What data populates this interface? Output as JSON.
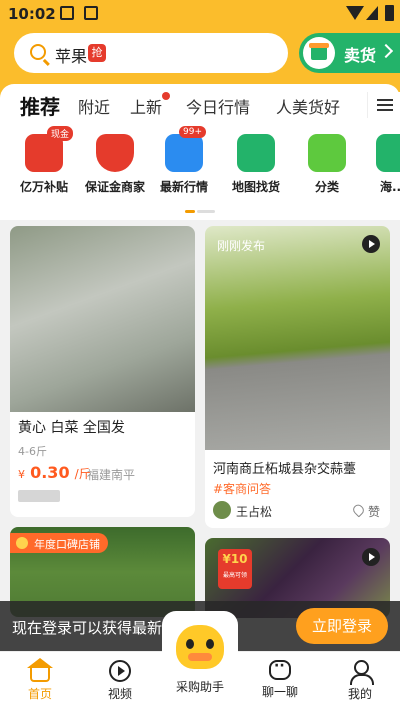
{
  "status_bar": {
    "time": "10:02"
  },
  "search": {
    "query": "苹果",
    "badge": "抢"
  },
  "sell_button": {
    "label": "卖货"
  },
  "tabs": [
    {
      "label": "推荐",
      "active": true
    },
    {
      "label": "附近"
    },
    {
      "label": "上新",
      "has_dot": true
    },
    {
      "label": "今日行情"
    },
    {
      "label": "人美货好"
    }
  ],
  "categories": [
    {
      "label": "亿万补贴",
      "badge": "现金",
      "icon": "subsidy-envelope-icon",
      "color": "#e53b2c"
    },
    {
      "label": "保证金商家",
      "icon": "guarantee-shield-icon",
      "color": "#e53b2c"
    },
    {
      "label": "最新行情",
      "badge": "99+",
      "icon": "market-chart-icon",
      "color": "#2b8cf0"
    },
    {
      "label": "地图找货",
      "icon": "map-pin-icon",
      "color": "#23b36a"
    },
    {
      "label": "分类",
      "icon": "category-grid-icon",
      "color": "#5ec93e"
    },
    {
      "label": "海...",
      "icon": "seafood-icon",
      "color": "#23b36a"
    }
  ],
  "cards": {
    "c1": {
      "title": "黄心  白菜  全国发",
      "spec": "4-6斤",
      "price_currency": "¥",
      "price": "0.30",
      "price_unit": "/斤",
      "location": "福建南平"
    },
    "c2": {
      "published": "刚刚发布",
      "title": "河南商丘柘城县杂交蒜薹",
      "qa": "#客商问答",
      "user": "王占松",
      "like": "赞"
    },
    "c3": {
      "banner": "年度口碑店铺"
    },
    "c4": {
      "amount": "¥10",
      "note": "最高可领"
    }
  },
  "login_prompt": {
    "message": "现在登录可以获得最新优惠信息",
    "button": "立即登录"
  },
  "assistant": {
    "label": "采购助手"
  },
  "bottom_nav": [
    {
      "label": "首页",
      "active": true
    },
    {
      "label": "视频"
    },
    {
      "label": "聊一聊"
    },
    {
      "label": "我的"
    }
  ],
  "colors": {
    "brand": "#fbbd2c",
    "accent": "#ffa01e",
    "price": "#ff5a1f",
    "sell": "#23b36a"
  }
}
